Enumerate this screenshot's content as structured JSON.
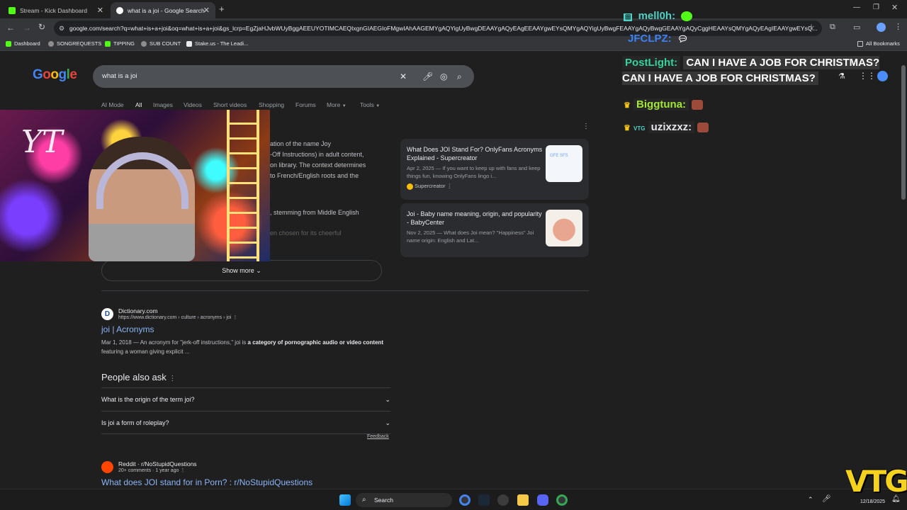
{
  "browser": {
    "tabs": [
      {
        "title": "Stream - Kick Dashboard",
        "favicon_color": "#53fc18",
        "active": false
      },
      {
        "title": "what is a joi - Google Search",
        "favicon_color": "#ffffff",
        "active": true
      }
    ],
    "new_tab": "+",
    "url": "google.com/search?q=what+is+a+joi&oq=what+is+a+joi&gs_lcrp=EgZjaHJvbWUyBggAEEUYOTIMCAEQIxgnGIAEGIoFMgwIAhAAGEMYgAQYigUyBwgDEAAYgAQyEAgEEAAYgwEYsQMYgAQYigUyBwgFEAAYgAQyBwgGEAAYgAQyCggHEAAYsQMYgAQyEAgIEAAYgwEYsQ...",
    "bookmarks": [
      {
        "label": "Dashboard",
        "color": "#53fc18"
      },
      {
        "label": "SONGREQUESTS",
        "color": "#8d8d8d"
      },
      {
        "label": "TIPPING",
        "color": "#53fc18"
      },
      {
        "label": "SUB COUNT",
        "color": "#8d8d8d"
      },
      {
        "label": "Stake.us - The Leadi...",
        "color": "#e8eaed"
      }
    ],
    "all_bookmarks": "All Bookmarks"
  },
  "google": {
    "logo": "Google",
    "query": "what is a joi",
    "tabs": [
      "AI Mode",
      "All",
      "Images",
      "Videos",
      "Short videos",
      "Shopping",
      "Forums",
      "More",
      "Tools"
    ],
    "overview_lines": [
      "ation of the name Joy",
      "-Off Instructions) in adult content,",
      "on library. The context determines",
      "to French/English roots and the",
      ", stemming from Middle English",
      "en chosen for its cheerful"
    ],
    "show_more": "Show more",
    "side_cards": [
      {
        "title": "What Does JOI Stand For? OnlyFans Acronyms Explained - Supercreator",
        "snippet": "Apr 2, 2025 — If you want to keep up with fans and keep things fun, knowing OnlyFans lingo i...",
        "source": "Supercreator",
        "thumb_text": "GFE SFS"
      },
      {
        "title": "Joi - Baby name meaning, origin, and popularity - BabyCenter",
        "snippet": "Nov 2, 2025 — What does Joi mean? \"Happiness\" Joi name origin: English and Lat..."
      }
    ],
    "result_dictionary": {
      "site": "Dictionary.com",
      "url": "https://www.dictionary.com › culture › acronyms › joi",
      "title": "joi | Acronyms",
      "date": "Mar 1, 2018",
      "snippet_pre": " — An acronym for \"jerk-off instructions,\" joi is ",
      "snippet_bold": "a category of pornographic audio or video content",
      "snippet_post": " featuring a woman giving explicit ..."
    },
    "paa": {
      "heading": "People also ask",
      "questions": [
        "What is the origin of the term joi?",
        "Is joi a form of roleplay?"
      ],
      "feedback": "Feedback"
    },
    "result_reddit": {
      "site": "Reddit · r/NoStupidQuestions",
      "meta": "20+ comments · 1 year ago",
      "title": "What does JOI stand for in Porn? : r/NoStupidQuestions"
    }
  },
  "webcam": {
    "overlay_text": "YT"
  },
  "chat": [
    {
      "badge": "VTG",
      "user": "mell0h:",
      "color": "#4fd1c5",
      "message": ""
    },
    {
      "badge": "",
      "user": "JFCLPZ:",
      "color": "#3b82f6",
      "message": ""
    },
    {
      "badge": "",
      "user": "PostLight:",
      "color": "#34d399",
      "message": "CAN I HAVE A JOB FOR CHRISTMAS?CAN I HAVE A JOB FOR CHRISTMAS?"
    },
    {
      "badge": "crown",
      "user": "Biggtuna:",
      "color": "#a3e635",
      "message": ""
    },
    {
      "badge": "crown VTG",
      "user": "uzixzxz:",
      "color": "#e5e7eb",
      "message": ""
    }
  ],
  "taskbar": {
    "search": "Search",
    "clock_time": "",
    "clock_date": "12/18/2025"
  },
  "watermark": "VTG"
}
